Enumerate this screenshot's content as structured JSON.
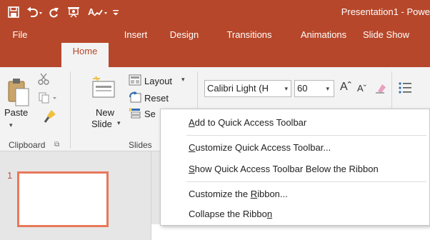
{
  "titlebar": {
    "title": "Presentation1 - Powe",
    "qat_items": [
      "save-icon",
      "undo-icon",
      "redo-icon",
      "present-from-beginning-icon",
      "spelling-icon",
      "customize-qat-icon"
    ]
  },
  "tabs": [
    {
      "label": "File"
    },
    {
      "label": "Home"
    },
    {
      "label": "Insert"
    },
    {
      "label": "Design"
    },
    {
      "label": "Transitions"
    },
    {
      "label": "Animations"
    },
    {
      "label": "Slide Show"
    }
  ],
  "ribbon": {
    "clipboard": {
      "paste_label": "Paste",
      "group_label": "Clipboard"
    },
    "slides": {
      "new_slide_line1": "New",
      "new_slide_line2": "Slide",
      "layout_label": "Layout",
      "reset_label": "Reset",
      "section_label": "Se",
      "group_label": "Slides"
    },
    "font": {
      "font_name": "Calibri Light (H",
      "font_size": "60"
    }
  },
  "slides_panel": {
    "slide_number": "1"
  },
  "context_menu": {
    "items": [
      {
        "label": "Add to Quick Access Toolbar",
        "accel": "A"
      },
      {
        "label": "Customize Quick Access Toolbar...",
        "accel": "C"
      },
      {
        "label": "Show Quick Access Toolbar Below the Ribbon",
        "accel": "S"
      },
      {
        "label": "Customize the Ribbon...",
        "accel": "R"
      },
      {
        "label": "Collapse the Ribbon",
        "accel": "n"
      }
    ]
  },
  "colors": {
    "accent": "#b7472a",
    "ribbon_bg": "#f3f3f3",
    "thumb_border": "#e8785a"
  }
}
